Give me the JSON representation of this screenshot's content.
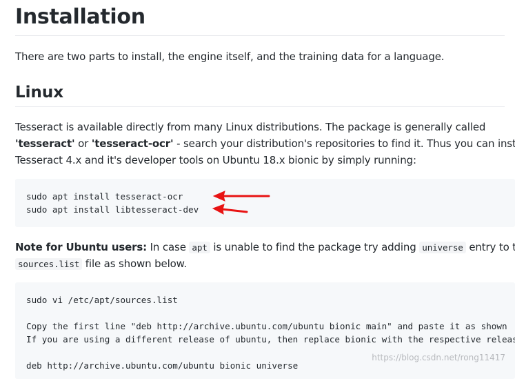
{
  "h1_title": "Installation",
  "intro": "There are two parts to install, the engine itself, and the training data for a language.",
  "h2_linux": "Linux",
  "linux_para": {
    "line1": "Tesseract is available directly from many Linux distributions. The package is generally called",
    "line2_q1": "'tesseract'",
    "line2_or": " or ",
    "line2_q2": "'tesseract-ocr'",
    "line2_rest": " - search your distribution's repositories to find it. Thus you can install",
    "line3": "Tesseract 4.x and it's developer tools on Ubuntu 18.x bionic by simply running:"
  },
  "code1": [
    "sudo apt install tesseract-ocr",
    "sudo apt install libtesseract-dev"
  ],
  "note": {
    "label": "Note for Ubuntu users:",
    "t1": " In case ",
    "code_apt": "apt",
    "t2": " is unable to find the package try adding ",
    "code_universe": "universe",
    "t3": " entry to the",
    "code_sources": "sources.list",
    "t4": " file as shown below."
  },
  "code2": [
    "sudo vi /etc/apt/sources.list",
    "",
    "Copy the first line \"deb http://archive.ubuntu.com/ubuntu bionic main\" and paste it as shown",
    "If you are using a different release of ubuntu, then replace bionic with the respective release",
    "",
    "deb http://archive.ubuntu.com/ubuntu bionic universe"
  ],
  "watermark": "https://blog.csdn.net/rong11417",
  "colors": {
    "arrow": "#e81313",
    "code_bg": "#f6f8fa",
    "text": "#24292e"
  }
}
